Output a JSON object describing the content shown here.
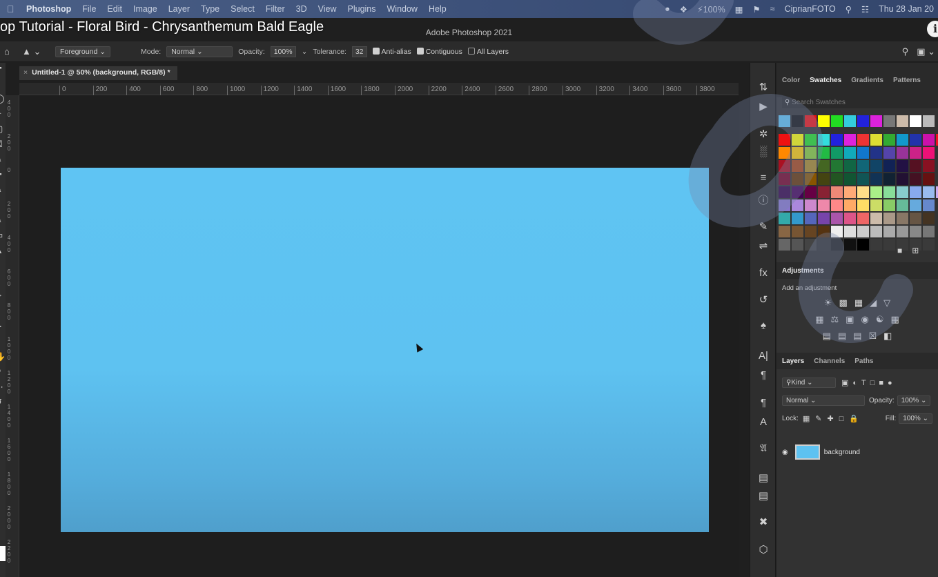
{
  "menubar": {
    "apple": "",
    "items": [
      "Photoshop",
      "File",
      "Edit",
      "Image",
      "Layer",
      "Type",
      "Select",
      "Filter",
      "3D",
      "View",
      "Plugins",
      "Window",
      "Help"
    ],
    "battery": "100%",
    "user": "CiprianFOTO",
    "datetime": "Thu 28 Jan 20"
  },
  "video": {
    "title": "op Tutorial - Floral Bird - Chrysanthemum Bald Eagle",
    "info": "i"
  },
  "window": {
    "title": "Adobe Photoshop 2021"
  },
  "options": {
    "fill_source": "Foreground",
    "mode_label": "Mode:",
    "mode_value": "Normal",
    "opacity_label": "Opacity:",
    "opacity_value": "100%",
    "tolerance_label": "Tolerance:",
    "tolerance_value": "32",
    "anti_alias": "Anti-alias",
    "contiguous": "Contiguous",
    "all_layers": "All Layers"
  },
  "document": {
    "tab_label": "Untitled-1 @ 50% (background, RGB/8) *",
    "ruler_ticks": [
      "0",
      "200",
      "400",
      "600",
      "800",
      "1000",
      "1200",
      "1400",
      "1600",
      "1800",
      "2000",
      "2200",
      "2400",
      "2600",
      "2800",
      "3000",
      "3200",
      "3400",
      "3600",
      "3800"
    ],
    "ruler_left": [
      "400",
      "200",
      "0",
      "200",
      "400",
      "600",
      "800",
      "1000",
      "1200",
      "1400",
      "1600",
      "1800",
      "2000",
      "2200"
    ],
    "canvas_color": "#5fc4f3"
  },
  "panels": {
    "top_tabs": [
      "Color",
      "Swatches",
      "Gradients",
      "Patterns"
    ],
    "active_top_tab": "Swatches",
    "swatch_search_placeholder": "Search Swatches",
    "adjustments_title": "Adjustments",
    "adjustments_sub": "Add an adjustment",
    "layer_tabs": [
      "Layers",
      "Channels",
      "Paths"
    ],
    "active_layer_tab": "Layers",
    "filter_kind": "Kind",
    "blend_mode": "Normal",
    "opacity_label": "Opacity:",
    "opacity_value": "100%",
    "lock_label": "Lock:",
    "fill_label": "Fill:",
    "fill_value": "100%",
    "layer_name": "background"
  }
}
